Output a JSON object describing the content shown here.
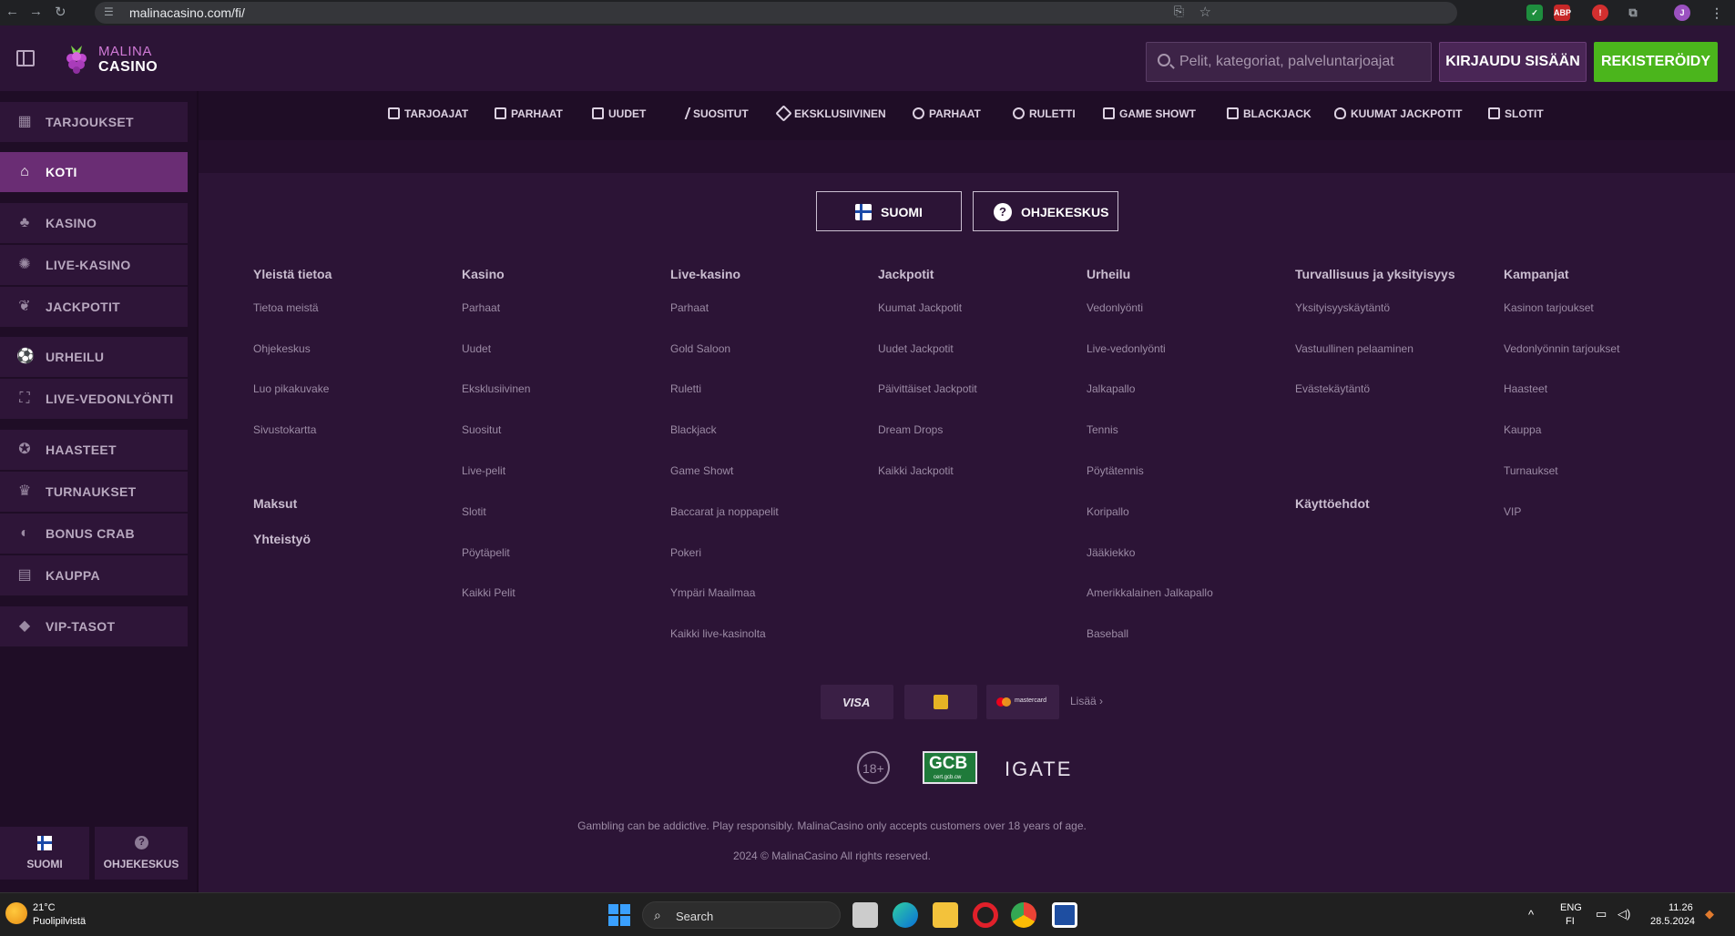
{
  "browser": {
    "url": "malinacasino.com/fi/",
    "avatar_letter": "J"
  },
  "header": {
    "logo_top": "MALINA",
    "logo_bottom": "CASINO",
    "search_placeholder": "Pelit, kategoriat, palveluntarjoajat",
    "login_label": "KIRJAUDU SISÄÄN",
    "register_label": "REKISTERÖIDY"
  },
  "sidebar": {
    "items": [
      {
        "label": "TARJOUKSET",
        "icon": "gift-icon"
      },
      {
        "label": "KOTI",
        "icon": "home-icon"
      },
      {
        "label": "KASINO",
        "icon": "cherries-icon"
      },
      {
        "label": "LIVE-KASINO",
        "icon": "roulette-icon"
      },
      {
        "label": "JACKPOTIT",
        "icon": "raspberry-icon"
      },
      {
        "label": "URHEILU",
        "icon": "football-icon"
      },
      {
        "label": "LIVE-VEDONLYÖNTI",
        "icon": "live-betting-icon"
      },
      {
        "label": "HAASTEET",
        "icon": "medal-icon"
      },
      {
        "label": "TURNAUKSET",
        "icon": "trophy-icon"
      },
      {
        "label": "BONUS CRAB",
        "icon": "crab-icon"
      },
      {
        "label": "KAUPPA",
        "icon": "shop-icon"
      },
      {
        "label": "VIP-TASOT",
        "icon": "diamond-icon"
      }
    ],
    "bottom_language": "SUOMI",
    "bottom_help": "OHJEKESKUS"
  },
  "categories": [
    {
      "label": "TARJOAJAT"
    },
    {
      "label": "PARHAAT"
    },
    {
      "label": "UUDET"
    },
    {
      "label": "SUOSITUT"
    },
    {
      "label": "EKSKLUSIIVINEN"
    },
    {
      "label": "PARHAAT"
    },
    {
      "label": "RULETTI"
    },
    {
      "label": "GAME SHOWT"
    },
    {
      "label": "BLACKJACK"
    },
    {
      "label": "KUUMAT JACKPOTIT"
    },
    {
      "label": "SLOTIT"
    }
  ],
  "footer": {
    "language_button": "SUOMI",
    "help_button": "OHJEKESKUS",
    "columns": [
      {
        "heading": "Yleistä tietoa",
        "links": [
          "Tietoa meistä",
          "Ohjekeskus",
          "Luo pikakuvake",
          "Sivustokartta"
        ]
      },
      {
        "heading": "Kasino",
        "links": [
          "Parhaat",
          "Uudet",
          "Eksklusiivinen",
          "Suositut",
          "Live-pelit",
          "Slotit",
          "Pöytäpelit",
          "Kaikki Pelit"
        ]
      },
      {
        "heading": "Live-kasino",
        "links": [
          "Parhaat",
          "Gold Saloon",
          "Ruletti",
          "Blackjack",
          "Game Showt",
          "Baccarat ja noppapelit",
          "Pokeri",
          "Ympäri Maailmaa",
          "Kaikki live-kasinolta"
        ]
      },
      {
        "heading": "Jackpotit",
        "links": [
          "Kuumat Jackpotit",
          "Uudet Jackpotit",
          "Päivittäiset Jackpotit",
          "Dream Drops",
          "Kaikki Jackpotit"
        ]
      },
      {
        "heading": "Urheilu",
        "links": [
          "Vedonlyönti",
          "Live-vedonlyönti",
          "Jalkapallo",
          "Tennis",
          "Pöytätennis",
          "Koripallo",
          "Jääkiekko",
          "Amerikkalainen Jalkapallo",
          "Baseball"
        ]
      },
      {
        "heading": "Turvallisuus ja yksityisyys",
        "links": [
          "Yksityisyyskäytäntö",
          "Vastuullinen pelaaminen",
          "Evästekäytäntö"
        ]
      },
      {
        "heading": "Kampanjat",
        "links": [
          "Kasinon tarjoukset",
          "Vedonlyönnin tarjoukset",
          "Haasteet",
          "Kauppa",
          "Turnaukset",
          "VIP"
        ]
      }
    ],
    "extra_headings": {
      "payments": "Maksut",
      "partners": "Yhteistyö",
      "terms": "Käyttöehdot"
    },
    "payment_methods": {
      "visa": "VISA",
      "mastercard": "mastercard",
      "more": "Lisää"
    },
    "badges": {
      "age": "18+",
      "gcb": "GCB",
      "gcb_sub": "cert.gcb.cw",
      "igate": "IGATE"
    },
    "disclaimer": "Gambling can be addictive. Play responsibly. MalinaCasino only accepts customers over 18 years of age.",
    "copyright": "2024 © MalinaCasino All rights reserved."
  },
  "taskbar": {
    "weather_temp": "21°C",
    "weather_desc": "Puolipilvistä",
    "search_label": "Search",
    "lang_top": "ENG",
    "lang_bottom": "FI",
    "time": "11.26",
    "date": "28.5.2024"
  },
  "colors": {
    "background": "#2c1436",
    "sidebar": "#1f0d26",
    "active": "#6a2d74",
    "register": "#4bb51c",
    "brand": "#d07ad6"
  }
}
